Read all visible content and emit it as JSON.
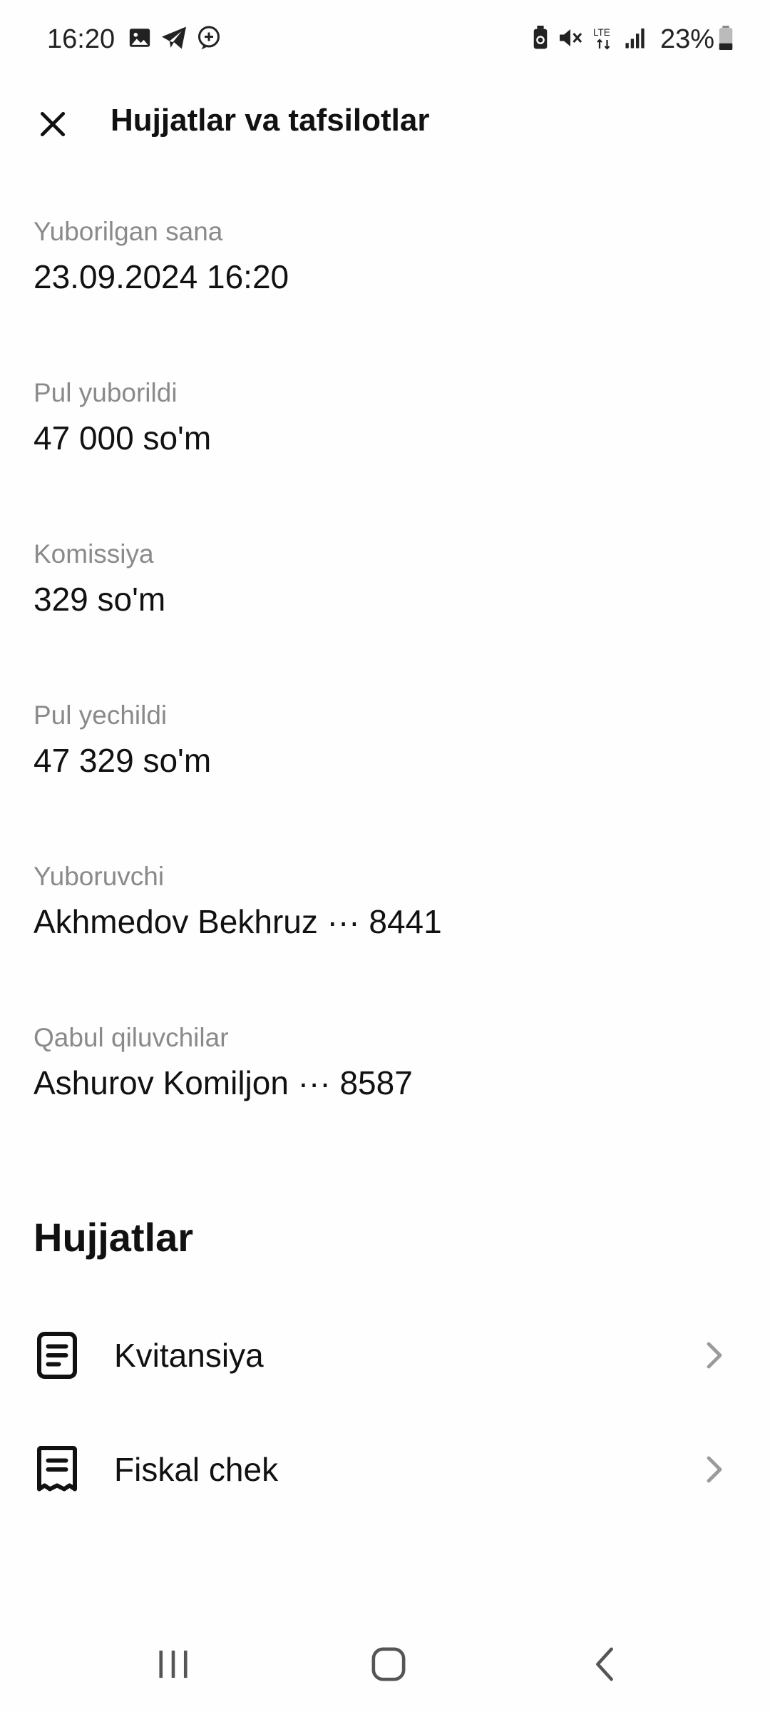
{
  "status_bar": {
    "time": "16:20",
    "battery_percent": "23%",
    "network": "LTE",
    "icons_left": [
      "gallery-icon",
      "telegram-icon",
      "chat-add-icon"
    ],
    "icons_right": [
      "battery-saver-icon",
      "mute-icon",
      "lte-icon",
      "signal-icon",
      "battery-icon"
    ]
  },
  "header": {
    "title": "Hujjatlar va tafsilotlar",
    "close_icon": "close-icon"
  },
  "details": [
    {
      "label": "Yuborilgan sana",
      "value": "23.09.2024 16:20"
    },
    {
      "label": "Pul yuborildi",
      "value": "47 000 so'm"
    },
    {
      "label": "Komissiya",
      "value": "329 so'm"
    },
    {
      "label": "Pul yechildi",
      "value": "47 329 so'm"
    },
    {
      "label": "Yuboruvchi",
      "value": "Akhmedov Bekhruz ··· 8441"
    },
    {
      "label": "Qabul qiluvchilar",
      "value": "Ashurov Komiljon ··· 8587"
    }
  ],
  "documents": {
    "title": "Hujjatlar",
    "items": [
      {
        "label": "Kvitansiya",
        "icon": "document-icon"
      },
      {
        "label": "Fiskal chek",
        "icon": "receipt-icon"
      }
    ]
  },
  "nav": {
    "icons": [
      "recent-apps-icon",
      "home-icon",
      "back-icon"
    ]
  },
  "colors": {
    "background": "#fefefe",
    "text": "#111111",
    "label": "#8a8a8a",
    "chevron": "#9a9a9a"
  }
}
